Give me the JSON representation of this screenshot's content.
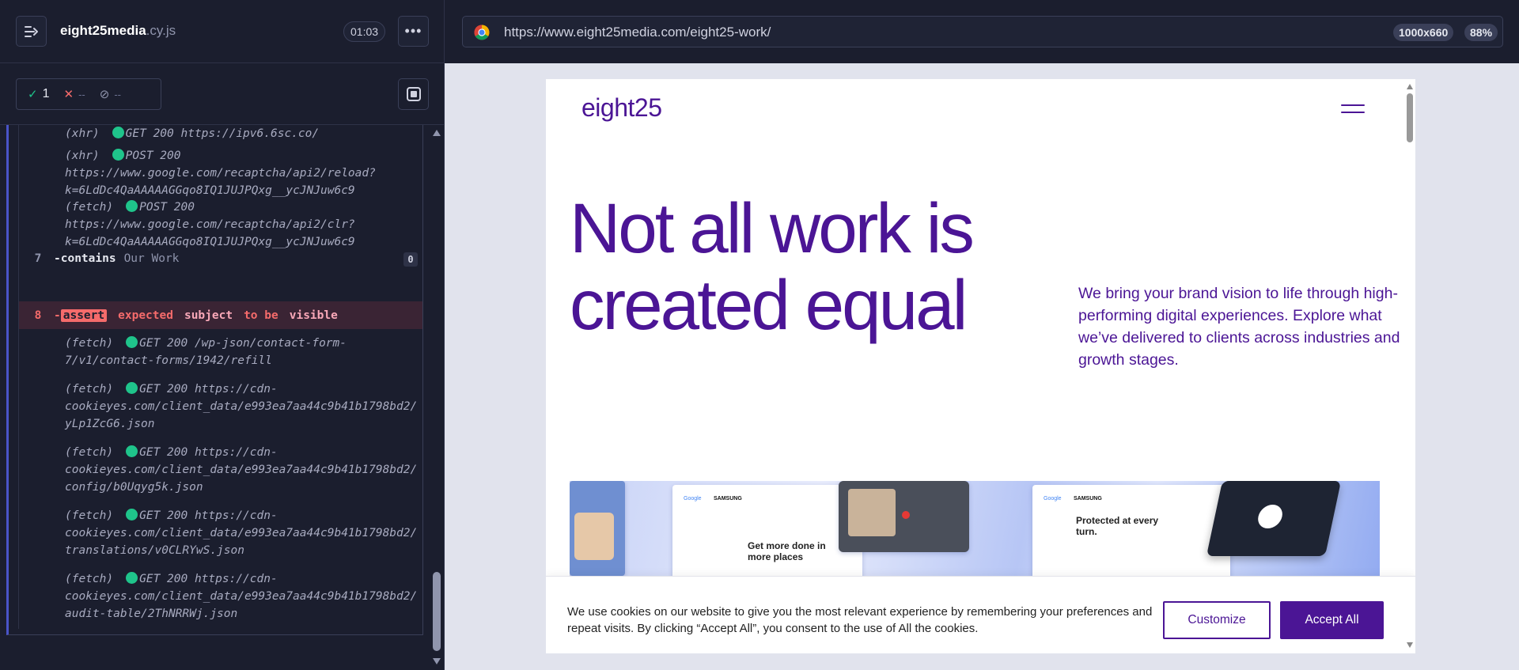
{
  "reporter": {
    "spec_name": "eight25media",
    "spec_ext": ".cy.js",
    "timer": "01:03",
    "menu_label": "•••",
    "stats": {
      "passed": "1",
      "failed": "--",
      "pending": "--"
    }
  },
  "log": {
    "entries": [
      {
        "type": "(xhr)",
        "text": "GET 200 https://ipv6.6sc.co/",
        "cont": []
      },
      {
        "type": "(xhr)",
        "text": "POST 200",
        "cont": [
          "https://www.google.com/recaptcha/api2/reload?",
          "k=6LdDc4QaAAAAAGGqo8IQ1JUJPQxg__ycJNJuw6c9"
        ]
      },
      {
        "type": "(fetch)",
        "text": "POST 200",
        "cont": [
          "https://www.google.com/recaptcha/api2/clr?",
          "k=6LdDc4QaAAAAAGGqo8IQ1JUJPQxg__ycJNJuw6c9"
        ]
      },
      {
        "type": "(fetch)",
        "text": "GET 200 /wp-json/contact-form-",
        "cont": [
          "7/v1/contact-forms/1942/refill"
        ]
      },
      {
        "type": "(fetch)",
        "text": "GET 200 https://cdn-",
        "cont": [
          "cookieyes.com/client_data/e993ea7aa44c9b41b1798bd2/",
          "yLp1ZcG6.json"
        ]
      },
      {
        "type": "(fetch)",
        "text": "GET 200 https://cdn-",
        "cont": [
          "cookieyes.com/client_data/e993ea7aa44c9b41b1798bd2/",
          "config/b0Uqyg5k.json"
        ]
      },
      {
        "type": "(fetch)",
        "text": "GET 200 https://cdn-",
        "cont": [
          "cookieyes.com/client_data/e993ea7aa44c9b41b1798bd2/",
          "translations/v0CLRYwS.json"
        ]
      },
      {
        "type": "(fetch)",
        "text": "GET 200 https://cdn-",
        "cont": [
          "cookieyes.com/client_data/e993ea7aa44c9b41b1798bd2/",
          "audit-table/2ThNRRWj.json"
        ]
      }
    ],
    "cmd7": {
      "num": "7",
      "dash": "-",
      "name": "contains",
      "arg": "Our Work",
      "badge": "0"
    },
    "cmd8": {
      "num": "8",
      "dash": "-",
      "name": "assert",
      "w1": "expected",
      "w2": "subject",
      "w3": "to be",
      "w4": "visible"
    }
  },
  "aut": {
    "url": "https://www.eight25media.com/eight25-work/",
    "viewport_size": "1000x660",
    "zoom": "88%"
  },
  "site": {
    "logo": "eight25",
    "headline_line1": "Not all work is",
    "headline_line2": "created equal",
    "intro": "We bring your brand vision to life through high-performing digital experiences. Explore what we’ve delivered to clients across industries and growth stages.",
    "tile1_title": "Get more done in more places",
    "tile2_title": "Protected at every turn.",
    "tile_brand_a": "Google",
    "tile_brand_b": "SAMSUNG"
  },
  "cookie": {
    "text": "We use cookies on our website to give you the most relevant experience by remembering your preferences and repeat visits. By clicking “Accept All”, you consent to the use of All the cookies.",
    "customize": "Customize",
    "accept": "Accept All"
  },
  "colors": {
    "brand": "#4b1595",
    "pass": "#1fc48b",
    "fail": "#f56b6b",
    "panel_bg": "#1b1e2e"
  }
}
